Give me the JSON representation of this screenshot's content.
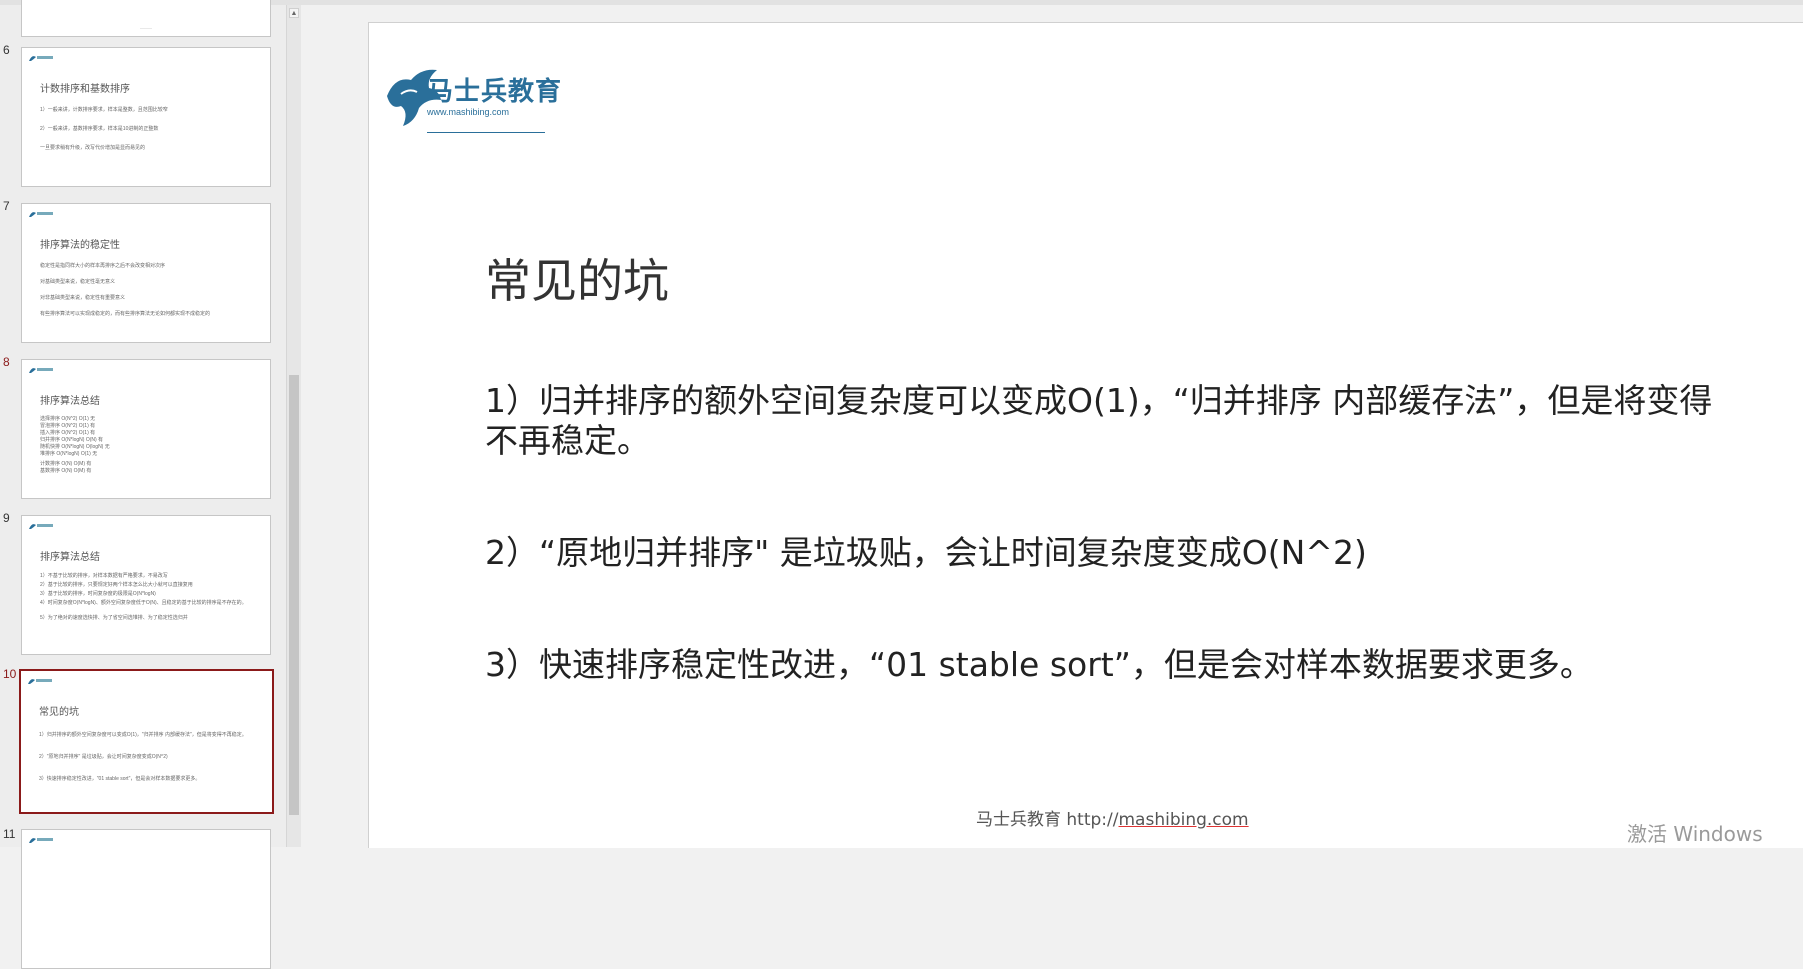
{
  "thumbnails": [
    {
      "num": "6",
      "title": "计数排序和基数排序",
      "lines": [
        "1）一般来讲，计数排序要求，样本是整数，且范围比较窄",
        "2）一般来讲，基数排序要求，样本是10进制的正整数",
        "一旦要求稍有升级，改写代价增加是显而易见的"
      ],
      "selected": false
    },
    {
      "num": "7",
      "title": "排序算法的稳定性",
      "lines": [
        "稳定性是指同样大小的样本再排序之后不会改变相对次序",
        "对基础类型来说，稳定性毫无意义",
        "对非基础类型来说，稳定性有重要意义",
        "有些排序算法可以实现成稳定的，而有些排序算法无论如何都实现不成稳定的"
      ],
      "selected": false
    },
    {
      "num": "8",
      "title": "排序算法总结",
      "lines": [
        "选择排序   O(N^2)   O(1)   无",
        "冒泡排序   O(N^2)   O(1)   有",
        "插入排序   O(N^2)   O(1)   有",
        "归并排序   O(N*logN)   O(N)   有",
        "随机快排   O(N*logN)   O(logN)   无",
        "堆排序   O(N*logN)   O(1)   无",
        "计数排序   O(N)   O(M)   有",
        "基数排序   O(N)   O(M)   有"
      ],
      "selected": false
    },
    {
      "num": "9",
      "title": "排序算法总结",
      "lines": [
        "1）不基于比较的排序，对样本数据有严格要求，不易改写",
        "2）基于比较的排序，只要规定好两个样本怎么比大小就可以直接复用",
        "3）基于比较的排序，时间复杂度的极限是O(N*logN)",
        "4）时间复杂度O(N*logN)、额外空间复杂度低于O(N)、且稳定的基于比较的排序是不存在的。",
        "5）为了绝对的速度选快排、为了省空间选堆排、为了稳定性选归并"
      ],
      "selected": false
    },
    {
      "num": "10",
      "title": "常见的坑",
      "lines": [
        "1）归并排序的额外空间复杂度可以变成O(1)，\"归并排序 内部缓存法\"，但是将变得不再稳定。",
        "2）\"原地归并排序\" 是垃圾贴，会让时间复杂度变成O(N^2)",
        "3）快速排序稳定性改进，\"01 stable sort\"，但是会对样本数据要求更多。"
      ],
      "selected": true
    },
    {
      "num": "11",
      "title": "",
      "lines": [],
      "selected": false
    }
  ],
  "slide": {
    "logo_text": "马士兵教育",
    "logo_url": "www.mashibing.com",
    "title": "常见的坑",
    "points": [
      "1）归并排序的额外空间复杂度可以变成O(1)，“归并排序 内部缓存法”，但是将变得不再稳定。",
      "2）“原地归并排序\" 是垃圾贴，会让时间复杂度变成O(N^2)",
      "3）快速排序稳定性改进，“01 stable sort”，但是会对样本数据要求更多。"
    ],
    "footer_prefix": "马士兵教育 http://",
    "footer_url": "mashibing.com"
  },
  "watermark": "激活 Windows",
  "colors": {
    "accent": "#8b1a1a",
    "logo": "#2a6f9a"
  }
}
